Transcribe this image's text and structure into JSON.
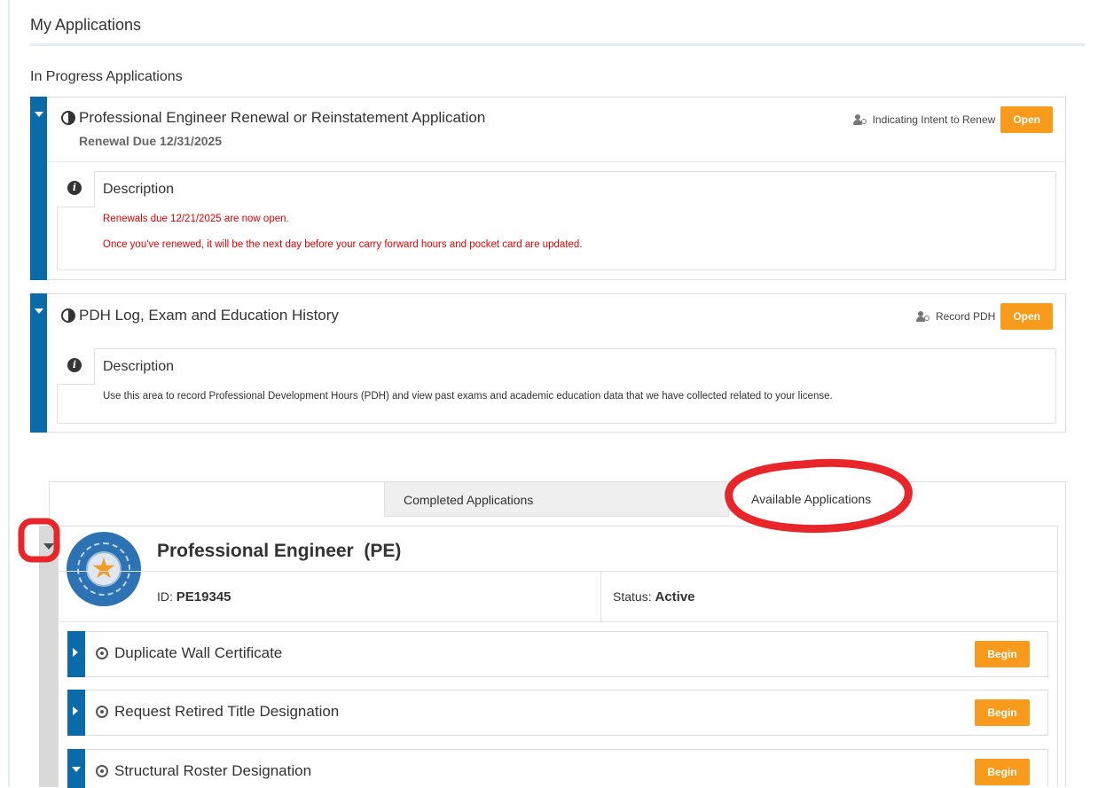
{
  "page": {
    "title": "My Applications"
  },
  "in_progress": {
    "heading": "In Progress Applications",
    "items": [
      {
        "title": "Professional Engineer Renewal or Reinstatement Application",
        "subtitle": "Renewal Due 12/31/2025",
        "action_text": "Indicating Intent to Renew",
        "button": "Open",
        "description_heading": "Description",
        "description_lines": [
          "Renewals due 12/21/2025 are now open.",
          "Once you've renewed, it will be the next day before your carry forward hours and pocket card are updated."
        ]
      },
      {
        "title": "PDH Log, Exam and Education History",
        "action_text": "Record PDH",
        "button": "Open",
        "description_heading": "Description",
        "description_lines": [
          "Use this area to record Professional Development Hours (PDH) and view past exams and academic education data that we have collected related to your license."
        ]
      }
    ]
  },
  "tabs": {
    "completed": "Completed Applications",
    "available": "Available Applications"
  },
  "license": {
    "title": "Professional Engineer  (PE)",
    "id_label": "ID:",
    "id_value": "PE19345",
    "status_label": "Status:",
    "status_value": "Active"
  },
  "available_apps": [
    {
      "label": "Duplicate Wall Certificate",
      "button": "Begin",
      "expanded": false
    },
    {
      "label": "Request Retired Title Designation",
      "button": "Begin",
      "expanded": false
    },
    {
      "label": "Structural Roster Designation",
      "button": "Begin",
      "expanded": true
    }
  ],
  "colors": {
    "accent_blue": "#0b6aa8",
    "button_orange": "#f89a1c",
    "alert_red": "#e60000",
    "annotation_red": "#e8262a"
  },
  "icons": [
    "half-circle-icon",
    "person-clock-icon",
    "info-icon",
    "target-icon",
    "caret-down-icon",
    "caret-right-icon",
    "star-badge-icon"
  ]
}
